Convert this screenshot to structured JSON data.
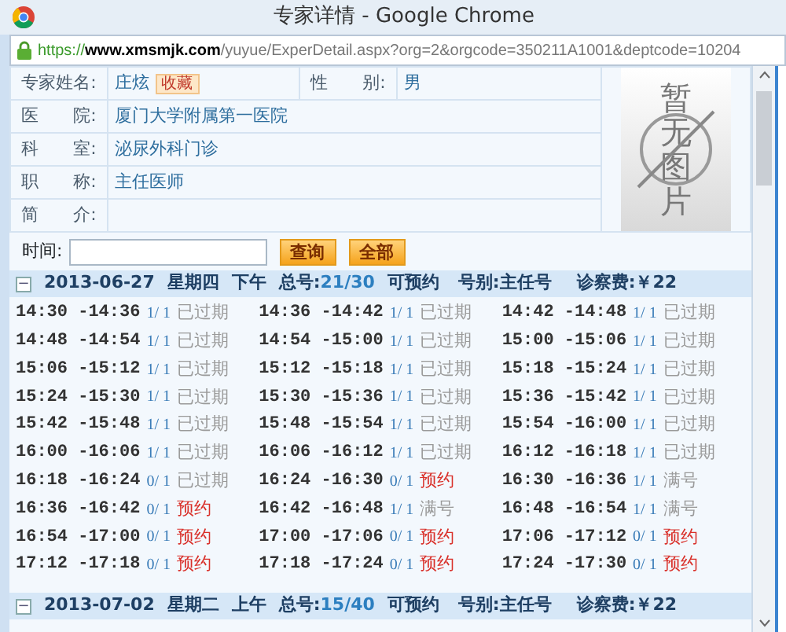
{
  "window": {
    "title": "专家详情 - Google Chrome"
  },
  "address_bar": {
    "scheme": "https://",
    "host": "www.xmsmjk.com",
    "path": "/yuyue/ExperDetail.aspx?org=2&orgcode=350211A1001&deptcode=10204"
  },
  "expert": {
    "name_label": "专家姓名:",
    "name": "庄炫",
    "favorite": "收藏",
    "gender_label": "性　　别:",
    "gender": "男",
    "rows": [
      {
        "label": "医　　院:",
        "value": "厦门大学附属第一医院"
      },
      {
        "label": "科　　室:",
        "value": "泌尿外科门诊"
      },
      {
        "label": "职　　称:",
        "value": "主任医师"
      },
      {
        "label": "简　　介:"
      }
    ],
    "photo": "暂无图片"
  },
  "search": {
    "label": "时间:",
    "buttons": [
      "查询",
      "全部"
    ]
  },
  "sessions": [
    {
      "expanded": true,
      "toggle": "−",
      "date": "2013-06-27",
      "weekday": "星期四",
      "period": "下午",
      "total_label": "总号:",
      "total": "21/30",
      "status": "可预约",
      "type": "号别:主任号",
      "fee": "诊察费:￥22",
      "slots": [
        {
          "time": "14:30 -14:36",
          "count": "1/ 1",
          "status": "已过期",
          "kind": "expired"
        },
        {
          "time": "14:36 -14:42",
          "count": "1/ 1",
          "status": "已过期",
          "kind": "expired"
        },
        {
          "time": "14:42 -14:48",
          "count": "1/ 1",
          "status": "已过期",
          "kind": "expired"
        },
        {
          "time": "14:48 -14:54",
          "count": "1/ 1",
          "status": "已过期",
          "kind": "expired"
        },
        {
          "time": "14:54 -15:00",
          "count": "1/ 1",
          "status": "已过期",
          "kind": "expired"
        },
        {
          "time": "15:00 -15:06",
          "count": "1/ 1",
          "status": "已过期",
          "kind": "expired"
        },
        {
          "time": "15:06 -15:12",
          "count": "1/ 1",
          "status": "已过期",
          "kind": "expired"
        },
        {
          "time": "15:12 -15:18",
          "count": "1/ 1",
          "status": "已过期",
          "kind": "expired"
        },
        {
          "time": "15:18 -15:24",
          "count": "1/ 1",
          "status": "已过期",
          "kind": "expired"
        },
        {
          "time": "15:24 -15:30",
          "count": "1/ 1",
          "status": "已过期",
          "kind": "expired"
        },
        {
          "time": "15:30 -15:36",
          "count": "1/ 1",
          "status": "已过期",
          "kind": "expired"
        },
        {
          "time": "15:36 -15:42",
          "count": "1/ 1",
          "status": "已过期",
          "kind": "expired"
        },
        {
          "time": "15:42 -15:48",
          "count": "1/ 1",
          "status": "已过期",
          "kind": "expired"
        },
        {
          "time": "15:48 -15:54",
          "count": "1/ 1",
          "status": "已过期",
          "kind": "expired"
        },
        {
          "time": "15:54 -16:00",
          "count": "1/ 1",
          "status": "已过期",
          "kind": "expired"
        },
        {
          "time": "16:00 -16:06",
          "count": "1/ 1",
          "status": "已过期",
          "kind": "expired"
        },
        {
          "time": "16:06 -16:12",
          "count": "1/ 1",
          "status": "已过期",
          "kind": "expired"
        },
        {
          "time": "16:12 -16:18",
          "count": "1/ 1",
          "status": "已过期",
          "kind": "expired"
        },
        {
          "time": "16:18 -16:24",
          "count": "0/ 1",
          "status": "已过期",
          "kind": "expired"
        },
        {
          "time": "16:24 -16:30",
          "count": "0/ 1",
          "status": "预约",
          "kind": "book"
        },
        {
          "time": "16:30 -16:36",
          "count": "1/ 1",
          "status": "满号",
          "kind": "full"
        },
        {
          "time": "16:36 -16:42",
          "count": "0/ 1",
          "status": "预约",
          "kind": "book"
        },
        {
          "time": "16:42 -16:48",
          "count": "1/ 1",
          "status": "满号",
          "kind": "full"
        },
        {
          "time": "16:48 -16:54",
          "count": "1/ 1",
          "status": "满号",
          "kind": "full"
        },
        {
          "time": "16:54 -17:00",
          "count": "0/ 1",
          "status": "预约",
          "kind": "book"
        },
        {
          "time": "17:00 -17:06",
          "count": "0/ 1",
          "status": "预约",
          "kind": "book"
        },
        {
          "time": "17:06 -17:12",
          "count": "0/ 1",
          "status": "预约",
          "kind": "book"
        },
        {
          "time": "17:12 -17:18",
          "count": "0/ 1",
          "status": "预约",
          "kind": "book"
        },
        {
          "time": "17:18 -17:24",
          "count": "0/ 1",
          "status": "预约",
          "kind": "book"
        },
        {
          "time": "17:24 -17:30",
          "count": "0/ 1",
          "status": "预约",
          "kind": "book"
        }
      ]
    },
    {
      "expanded": true,
      "toggle": "−",
      "date": "2013-07-02",
      "weekday": "星期二",
      "period": "上午",
      "total_label": "总号:",
      "total": "15/40",
      "status": "可预约",
      "type": "号别:主任号",
      "fee": "诊察费:￥22"
    }
  ]
}
